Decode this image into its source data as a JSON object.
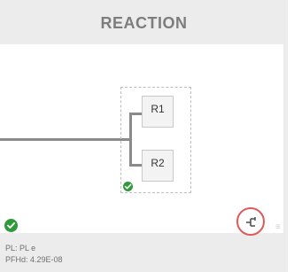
{
  "card": {
    "title": "REACTION"
  },
  "diagram": {
    "blocks": [
      {
        "label": "R1"
      },
      {
        "label": "R2"
      }
    ]
  },
  "status": {
    "pl_text": "PL: PL e",
    "pfhd_text": "PFHd: 4.29E-08"
  },
  "colors": {
    "ok": "#2e9a3a",
    "highlight": "#e05a5a",
    "title": "#7d7d7d"
  },
  "icons": {
    "status": "check-circle-icon",
    "branch_button": "branch-icon"
  }
}
